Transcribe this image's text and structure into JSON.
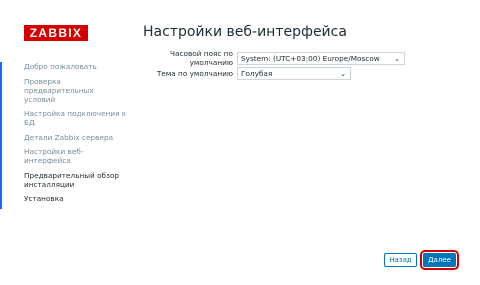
{
  "logo": {
    "text": "ZABBIX"
  },
  "page": {
    "title": "Настройки веб-интерфейса"
  },
  "sidebar": {
    "items": [
      {
        "label": "Добро пожаловать",
        "state": "done"
      },
      {
        "label": "Проверка предварительных условий",
        "state": "done"
      },
      {
        "label": "Настройка подключения к БД",
        "state": "done"
      },
      {
        "label": "Детали Zabbix сервера",
        "state": "done"
      },
      {
        "label": "Настройки веб-интерфейса",
        "state": "done"
      },
      {
        "label": "Предварительный обзор инсталляции",
        "state": "pending"
      },
      {
        "label": "Установка",
        "state": "pending"
      }
    ]
  },
  "form": {
    "timezone": {
      "label": "Часовой пояс по умолчанию",
      "value": "System: (UTC+03:00) Europe/Moscow"
    },
    "theme": {
      "label": "Тема по умолчанию",
      "value": "Голубая"
    }
  },
  "buttons": {
    "back": "Назад",
    "next": "Далее"
  },
  "colors": {
    "brand": "#d40000",
    "accent": "#0275b8",
    "step_done": "#768d99",
    "step_pending": "#1f2c33"
  }
}
